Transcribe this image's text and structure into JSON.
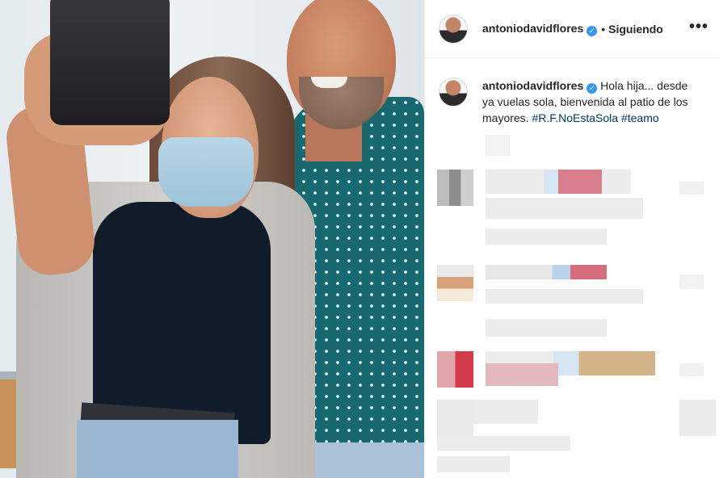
{
  "post": {
    "username": "antoniodavidflores",
    "separator": "•",
    "follow_status": "Siguiendo",
    "more_icon": "•••",
    "verified_mark": "✓",
    "caption": {
      "username": "antoniodavidflores",
      "text": "Hola hija... desde ya vuelas sola, bienvenida al patio de los mayores.",
      "hashtags": [
        "#R.F.NoEstaSola",
        "#teamo"
      ]
    }
  },
  "colors": {
    "verified": "#3897f0",
    "hashtag": "#00376b",
    "shirt": "#17696f"
  }
}
